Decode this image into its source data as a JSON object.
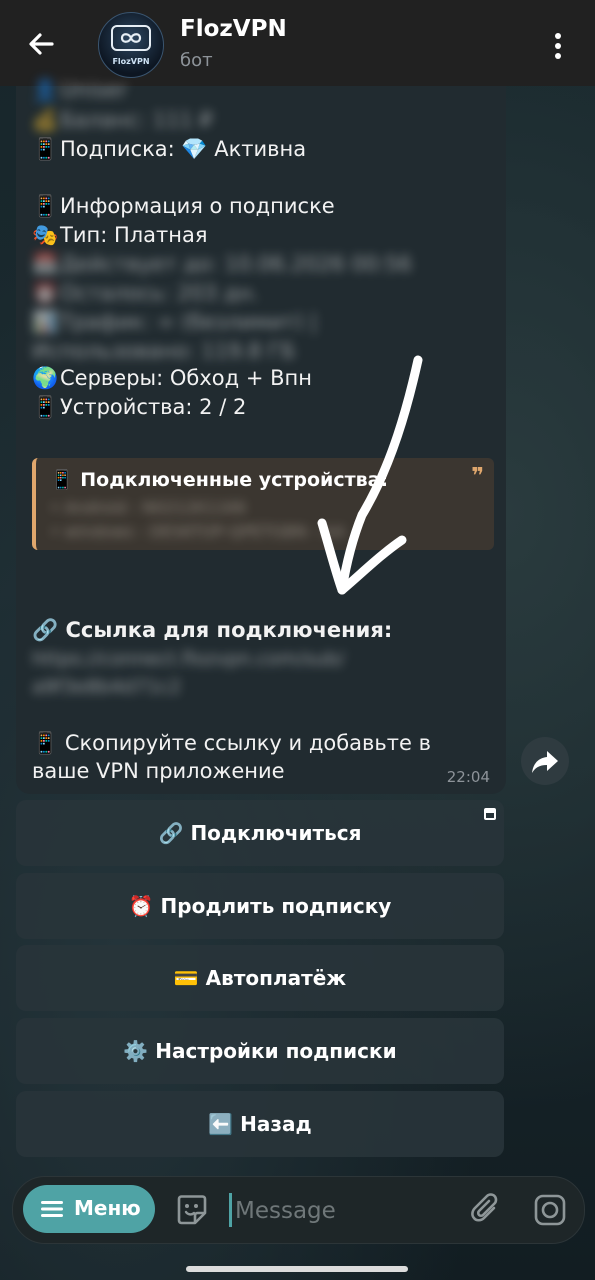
{
  "header": {
    "title": "FlozVPN",
    "subtitle": "бот",
    "avatar_text": "FlozVPN"
  },
  "message": {
    "lines": [
      {
        "emoji": "👤",
        "text": "Uniser"
      },
      {
        "emoji": "💰",
        "text": "Баланс: 111 ₽"
      },
      {
        "emoji": "📱",
        "text": "Подписка: 💎 Активна"
      },
      {
        "emoji": "📱",
        "text": "Информация о подписке"
      },
      {
        "emoji": "🎭",
        "text": "Тип: Платная"
      },
      {
        "emoji": "📅",
        "text": "Действует до: 10.06.2026 00:56"
      },
      {
        "emoji": "⏰",
        "text": "Осталось: 203 дн."
      },
      {
        "emoji": "📊",
        "text": "Трафик: ∞ (безлимит) |"
      },
      {
        "emoji": "",
        "text": "Использовано: 119.8 ГБ"
      },
      {
        "emoji": "🌍",
        "text": "Серверы: Обход + Впн"
      },
      {
        "emoji": "📱",
        "text": "Устройства: 2 / 2"
      }
    ],
    "quote": {
      "title": "📱 Подключенные устройства:",
      "mark": "❞",
      "items": [
        "• Android - N0212K1166",
        "• windows - DESKTOP-QPETGBN - AA"
      ]
    },
    "link_label": "🔗 Ссылка для подключения:",
    "link_lines": [
      "https://connect.flozvpn.com/sub/",
      "a9f3e8b4d71c2"
    ],
    "footer_line1": "📱 Скопируйте ссылку и добавьте в",
    "footer_line2": "ваше VPN приложение",
    "time": "22:04"
  },
  "keyboard": [
    {
      "label": "🔗 Подключиться"
    },
    {
      "label": "⏰ Продлить подписку"
    },
    {
      "label": "💳 Автоплатёж"
    },
    {
      "label": "⚙️ Настройки подписки"
    },
    {
      "label": "⬅️ Назад"
    }
  ],
  "input": {
    "menu_label": "Меню",
    "placeholder": "Message"
  },
  "colors": {
    "accent": "#4fa3a5",
    "quote_border": "#e0a76d",
    "header_bg": "#212121",
    "bubble_bg": "#212b30"
  }
}
